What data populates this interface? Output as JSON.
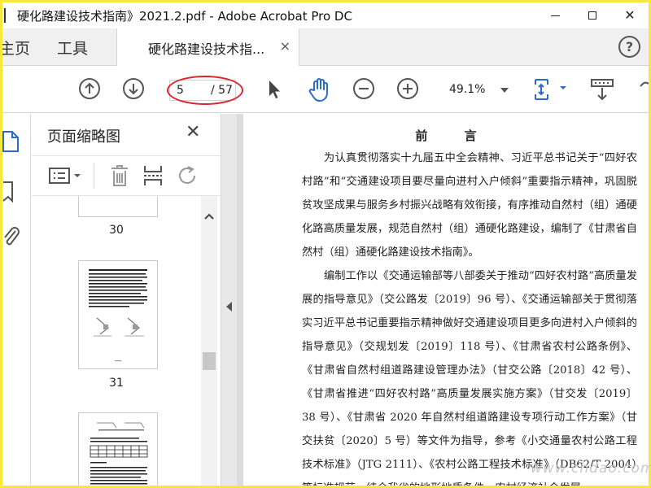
{
  "window": {
    "title": "硬化路建设技术指南》2021.2.pdf - Adobe Acrobat Pro DC"
  },
  "tabs": {
    "home_label": "主页",
    "tools_label": "工具",
    "document_label": "硬化路建设技术指...",
    "close_glyph": "×"
  },
  "toolbar": {
    "current_page": "5",
    "total_pages": "/ 57",
    "zoom": "49.1%"
  },
  "thumbnail_panel": {
    "title": "页面缩略图",
    "close_glyph": "✕",
    "page_labels": [
      "30",
      "31"
    ]
  },
  "document": {
    "heading": "前  言",
    "paragraphs": [
      "为认真贯彻落实十九届五中全会精神、习近平总书记关于“四好农村路”和“交通建设项目要尽量向进村入户倾斜”重要指示精神，巩固脱贫攻坚成果与服务乡村振兴战略有效衔接，有序推动自然村（组）通硬化路高质量发展，规范自然村（组）通硬化路建设，编制了《甘肃省自然村（组）通硬化路建设技术指南》。",
      "编制工作以《交通运输部等八部委关于推动“四好农村路”高质量发展的指导意见》（交公路发〔2019〕96 号）、《交通运输部关于贯彻落实习近平总书记重要指示精神做好交通建设项目更多向进村入户倾斜的指导意见》（交规划发〔2019〕118 号）、《甘肃省农村公路条例》、《甘肃省自然村组道路建设管理办法》（甘交公路〔2018〕42 号）、《甘肃省推进“四好农村路”高质量发展实施方案》（甘交发〔2019〕38 号）、《甘肃省 2020 年自然村组道路建设专项行动工作方案》（甘交扶贫〔2020〕5 号）等文件为指导，参考《小交通量农村公路工程技术标准》（JTG 2111）、《农村公路工程技术标准》（DB62/T 2004）等标准规范，结合我省的地形地质条件、农村经济社会发展"
    ]
  },
  "watermark": "www.chdao.com",
  "colors": {
    "screen_border": "#f7e93a",
    "highlight_ellipse": "#d9232e",
    "active_blue": "#2a6ad1"
  }
}
